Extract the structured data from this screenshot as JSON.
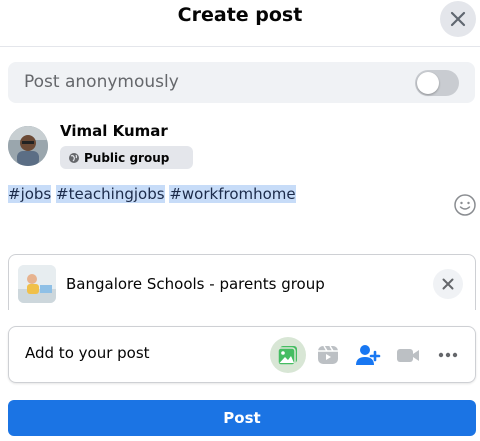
{
  "header": {
    "title": "Create post",
    "close_icon": "close-icon"
  },
  "anonymous": {
    "label": "Post anonymously",
    "enabled": false
  },
  "user": {
    "name": "Vimal Kumar",
    "audience": "Public group"
  },
  "composer": {
    "text_prefix": "",
    "hashtags": [
      "#jobs",
      "#teachingjobs",
      "#workfromhome"
    ]
  },
  "group": {
    "name": "Bangalore Schools - parents group"
  },
  "add_to_post": {
    "label": "Add to your post",
    "tools": [
      "photo-video-icon",
      "reel-icon",
      "tag-people-icon",
      "live-video-icon",
      "more-icon"
    ]
  },
  "post_button": {
    "label": "Post"
  },
  "colors": {
    "accent": "#1b74e4",
    "photo_green": "#45bd62",
    "people_blue": "#1877f2"
  }
}
